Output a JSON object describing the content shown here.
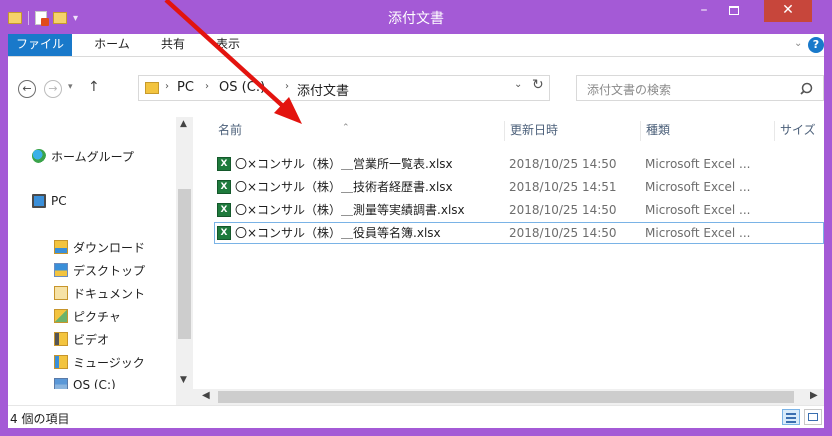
{
  "window": {
    "title": "添付文書",
    "minimize_glyph": "–",
    "close_glyph": "✕"
  },
  "ribbon": {
    "tabs": [
      "ファイル",
      "ホーム",
      "共有",
      "表示"
    ],
    "expand_glyph": "⌄",
    "help_glyph": "?"
  },
  "nav": {
    "back_glyph": "←",
    "forward_glyph": "→",
    "recent_glyph": "▾",
    "up_glyph": "↑"
  },
  "address": {
    "segments": [
      "PC",
      "OS (C:)",
      "添付文書"
    ],
    "chevron_glyph": "›",
    "dropdown_glyph": "⌄",
    "refresh_glyph": "↻"
  },
  "search": {
    "placeholder": "添付文書の検索"
  },
  "sidebar": {
    "items": [
      {
        "label": "ホームグループ",
        "icon": "homegroup-icon"
      },
      {
        "label": "PC",
        "icon": "pc-icon"
      },
      {
        "label": "ダウンロード",
        "icon": "download-folder-icon"
      },
      {
        "label": "デスクトップ",
        "icon": "desktop-folder-icon"
      },
      {
        "label": "ドキュメント",
        "icon": "documents-folder-icon"
      },
      {
        "label": "ピクチャ",
        "icon": "pictures-folder-icon"
      },
      {
        "label": "ビデオ",
        "icon": "videos-folder-icon"
      },
      {
        "label": "ミュージック",
        "icon": "music-folder-icon"
      },
      {
        "label": "OS (C:)",
        "icon": "drive-icon"
      }
    ]
  },
  "file_list": {
    "columns": [
      "名前",
      "更新日時",
      "種類",
      "サイズ"
    ],
    "rows": [
      {
        "name": "〇×コンサル（株）＿営業所一覧表.xlsx",
        "modified": "2018/10/25 14:50",
        "type": "Microsoft Excel ..."
      },
      {
        "name": "〇×コンサル（株）＿技術者経歴書.xlsx",
        "modified": "2018/10/25 14:51",
        "type": "Microsoft Excel ..."
      },
      {
        "name": "〇×コンサル（株）＿測量等実績調書.xlsx",
        "modified": "2018/10/25 14:50",
        "type": "Microsoft Excel ..."
      },
      {
        "name": "〇×コンサル（株）＿役員等名簿.xlsx",
        "modified": "2018/10/25 14:50",
        "type": "Microsoft Excel ..."
      }
    ],
    "file_icon_glyph": "X"
  },
  "status": {
    "item_count": "4 個の項目"
  },
  "colors": {
    "window_frame": "#a45ad6",
    "file_tab": "#1979ca",
    "close_button": "#c7463b",
    "annotation_arrow": "#e3140f"
  }
}
